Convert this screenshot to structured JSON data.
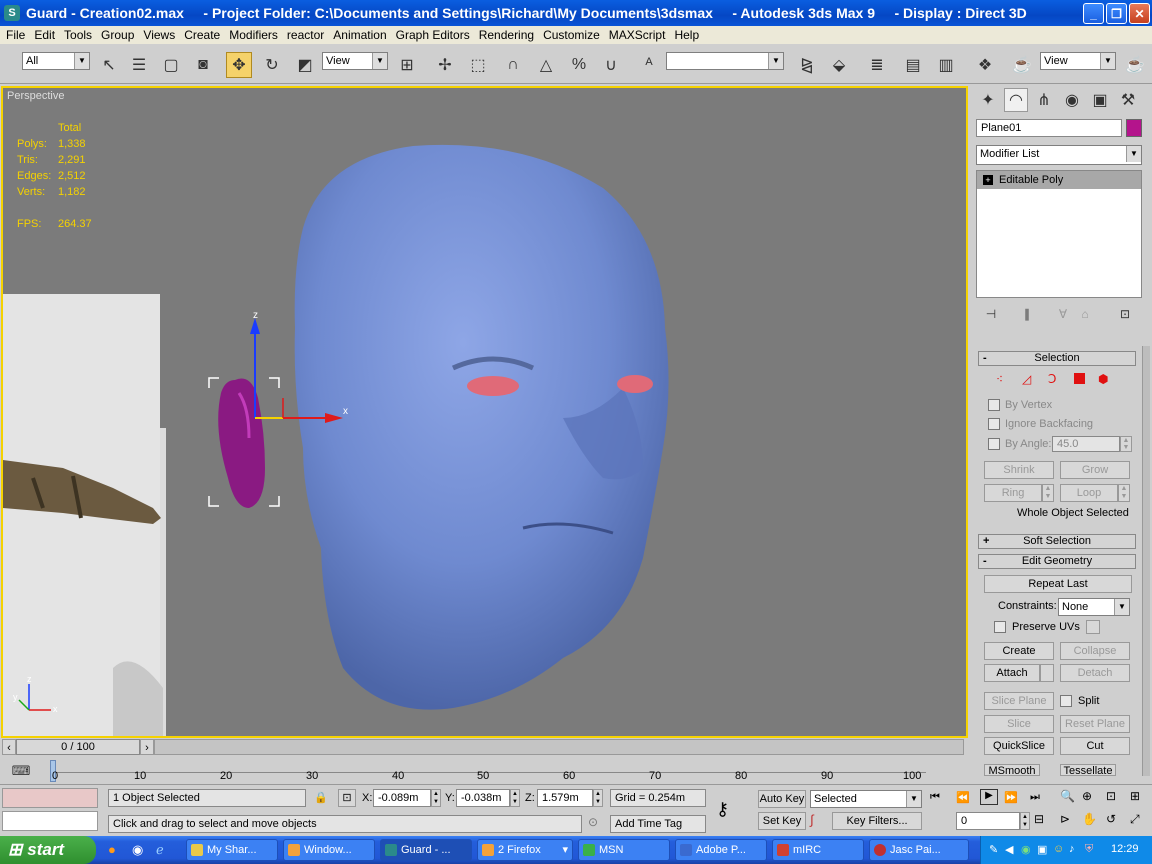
{
  "title_bar": {
    "text": "Guard - Creation02.max     - Project Folder: C:\\Documents and Settings\\Richard\\My Documents\\3dsmax     - Autodesk 3ds Max 9     - Display : Direct 3D"
  },
  "menu": [
    "File",
    "Edit",
    "Tools",
    "Group",
    "Views",
    "Create",
    "Modifiers",
    "reactor",
    "Animation",
    "Graph Editors",
    "Rendering",
    "Customize",
    "MAXScript",
    "Help"
  ],
  "toolbar": {
    "selection_filter": "All",
    "ref_coord": "View",
    "named_sel": "",
    "ref_coord2": "View"
  },
  "viewport": {
    "label": "Perspective",
    "stats": {
      "header": "Total",
      "polys_label": "Polys:",
      "polys": "1,338",
      "tris_label": "Tris:",
      "tris": "2,291",
      "edges_label": "Edges:",
      "edges": "2,512",
      "verts_label": "Verts:",
      "verts": "1,182",
      "fps_label": "FPS:",
      "fps": "264.37"
    },
    "gizmo_x": "x",
    "gizmo_z": "z",
    "axis_x": "x",
    "axis_y": "y",
    "axis_z": "z"
  },
  "command_panel": {
    "object_name": "Plane01",
    "modifier_list": "Modifier List",
    "stack_item": "Editable Poly",
    "selection": {
      "header": "Selection",
      "by_vertex": "By Vertex",
      "ignore_backfacing": "Ignore Backfacing",
      "by_angle": "By Angle:",
      "angle_value": "45.0",
      "shrink": "Shrink",
      "grow": "Grow",
      "ring": "Ring",
      "loop": "Loop",
      "status": "Whole Object Selected"
    },
    "soft_selection": {
      "header": "Soft Selection"
    },
    "edit_geometry": {
      "header": "Edit Geometry",
      "repeat_last": "Repeat Last",
      "constraints_label": "Constraints:",
      "constraints_value": "None",
      "preserve_uvs": "Preserve UVs",
      "create": "Create",
      "collapse": "Collapse",
      "attach": "Attach",
      "detach": "Detach",
      "slice_plane": "Slice Plane",
      "split": "Split",
      "slice": "Slice",
      "reset_plane": "Reset Plane",
      "quickslice": "QuickSlice",
      "cut": "Cut",
      "msmooth": "MSmooth",
      "tessellate": "Tessellate"
    }
  },
  "timeline": {
    "frame": "0 / 100",
    "ticks": [
      "0",
      "10",
      "20",
      "30",
      "40",
      "50",
      "60",
      "70",
      "80",
      "90",
      "100"
    ]
  },
  "status": {
    "selected": "1 Object Selected",
    "prompt": "Click and drag to select and move objects",
    "x_label": "X:",
    "x": "-0.089m",
    "y_label": "Y:",
    "y": "-0.038m",
    "z_label": "Z:",
    "z": "1.579m",
    "grid": "Grid = 0.254m",
    "add_time_tag": "Add Time Tag",
    "auto_key": "Auto Key",
    "set_key": "Set Key",
    "selected_dropdown": "Selected",
    "key_filters": "Key Filters...",
    "frame_value": "0"
  },
  "taskbar": {
    "start": "start",
    "tasks": [
      "My Shar...",
      "Window...",
      "Guard - ...",
      "2 Firefox",
      "MSN",
      "Adobe P...",
      "mIRC",
      "Jasc Pai..."
    ],
    "clock": "12:29"
  }
}
